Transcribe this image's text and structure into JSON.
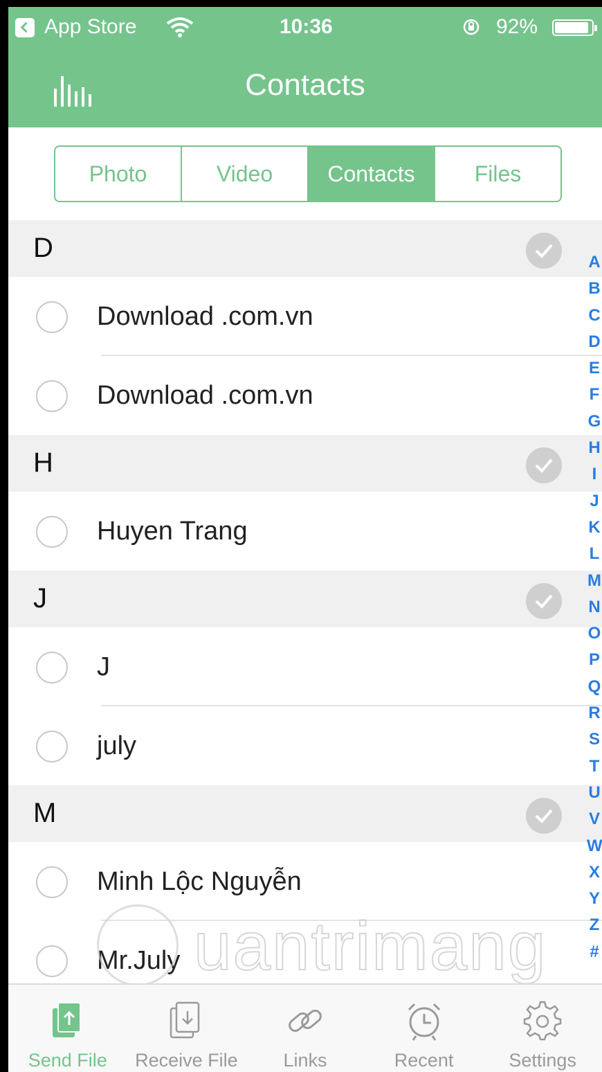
{
  "status_bar": {
    "back_app": "App Store",
    "time": "10:36",
    "battery_percent": "92%"
  },
  "nav": {
    "title": "Contacts"
  },
  "segments": [
    {
      "label": "Photo",
      "active": false
    },
    {
      "label": "Video",
      "active": false
    },
    {
      "label": "Contacts",
      "active": true
    },
    {
      "label": "Files",
      "active": false
    }
  ],
  "sections": [
    {
      "letter": "D",
      "contacts": [
        "Download .com.vn",
        "Download .com.vn"
      ]
    },
    {
      "letter": "H",
      "contacts": [
        "Huyen Trang"
      ]
    },
    {
      "letter": "J",
      "contacts": [
        "J",
        "july"
      ]
    },
    {
      "letter": "M",
      "contacts": [
        "Minh Lộc Nguyễn",
        "Mr.July"
      ]
    }
  ],
  "index_letters": [
    "A",
    "B",
    "C",
    "D",
    "E",
    "F",
    "G",
    "H",
    "I",
    "J",
    "K",
    "L",
    "M",
    "N",
    "O",
    "P",
    "Q",
    "R",
    "S",
    "T",
    "U",
    "V",
    "W",
    "X",
    "Y",
    "Z",
    "#"
  ],
  "watermark": "uantrimang",
  "tabs": [
    {
      "label": "Send File",
      "icon": "send-file-icon",
      "active": true
    },
    {
      "label": "Receive File",
      "icon": "receive-file-icon",
      "active": false
    },
    {
      "label": "Links",
      "icon": "link-icon",
      "active": false
    },
    {
      "label": "Recent",
      "icon": "alarm-clock-icon",
      "active": false
    },
    {
      "label": "Settings",
      "icon": "gear-icon",
      "active": false
    }
  ],
  "colors": {
    "accent": "#74c48c",
    "index": "#2a7de1",
    "section_bg": "#f0f0f0",
    "inactive_tab": "#9a9a9a"
  }
}
